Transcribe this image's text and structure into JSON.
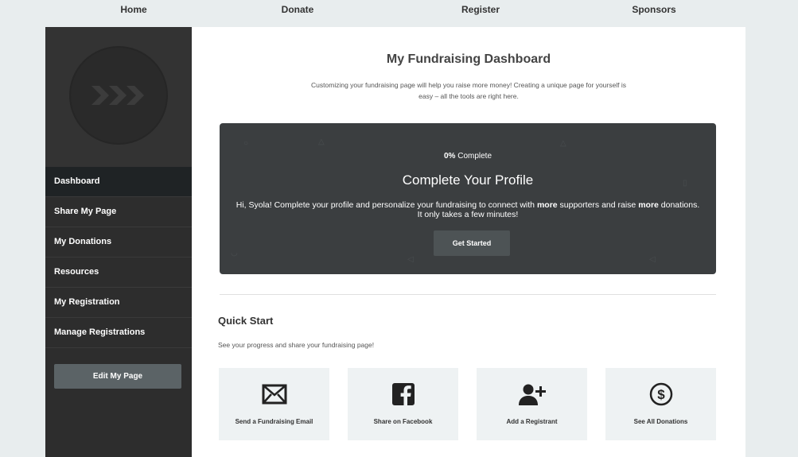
{
  "nav": {
    "items": [
      {
        "label": "Home"
      },
      {
        "label": "Donate"
      },
      {
        "label": "Register"
      },
      {
        "label": "Sponsors"
      }
    ]
  },
  "sidebar": {
    "items": [
      {
        "label": "Dashboard",
        "active": true
      },
      {
        "label": "Share My Page"
      },
      {
        "label": "My Donations"
      },
      {
        "label": "Resources"
      },
      {
        "label": "My Registration"
      },
      {
        "label": "Manage Registrations"
      }
    ],
    "edit_button": "Edit My Page"
  },
  "dashboard": {
    "title": "My Fundraising Dashboard",
    "subtitle": "Customizing your fundraising page will help you raise more money! Creating a unique page for yourself is easy – all the tools are right here."
  },
  "profile_card": {
    "percent": "0%",
    "percent_suffix": " Complete",
    "heading": "Complete Your Profile",
    "msg_part1": "Hi, Syola! Complete your profile and personalize your fundraising to connect with ",
    "msg_bold1": "more",
    "msg_part2": " supporters and raise ",
    "msg_bold2": "more",
    "msg_part3": " donations. It only takes a few minutes!",
    "button": "Get Started"
  },
  "quick_start": {
    "title": "Quick Start",
    "subtitle": "See your progress and share your fundraising page!",
    "tiles": [
      {
        "label": "Send a Fundraising Email",
        "icon": "envelope-icon"
      },
      {
        "label": "Share on Facebook",
        "icon": "facebook-icon"
      },
      {
        "label": "Add a Registrant",
        "icon": "add-user-icon"
      },
      {
        "label": "See All Donations",
        "icon": "dollar-circle-icon"
      }
    ]
  },
  "colors": {
    "sidebar_bg": "#2d2d2d",
    "card_bg": "#3b3e40",
    "page_bg": "#e8edee"
  }
}
